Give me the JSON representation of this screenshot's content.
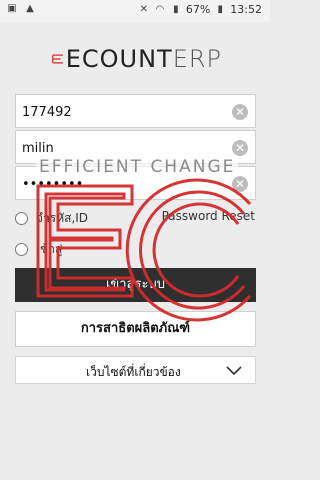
{
  "statusbar": {
    "battery": "67%",
    "time": "13:52"
  },
  "logo": {
    "brand": "ECOUNT",
    "suffix": "ERP"
  },
  "login": {
    "company_code": "177492",
    "user_id": "milin",
    "password": "••••••••"
  },
  "options": {
    "remember_label": "จำรหัส,ID",
    "password_reset": "Password Reset",
    "second_label": "เข้าสู่"
  },
  "buttons": {
    "login": "เข้าสู่ระบบ",
    "product_demo": "การสาธิตผลิตภัณฑ์"
  },
  "related_sites": {
    "label": "เว็บไซต์ที่เกี่ยวข้อง"
  },
  "overlay": {
    "tagline": "EFFICIENT CHANGE"
  },
  "colors": {
    "brand_red": "#d42b2b",
    "dark_button": "#2f2f2f"
  }
}
